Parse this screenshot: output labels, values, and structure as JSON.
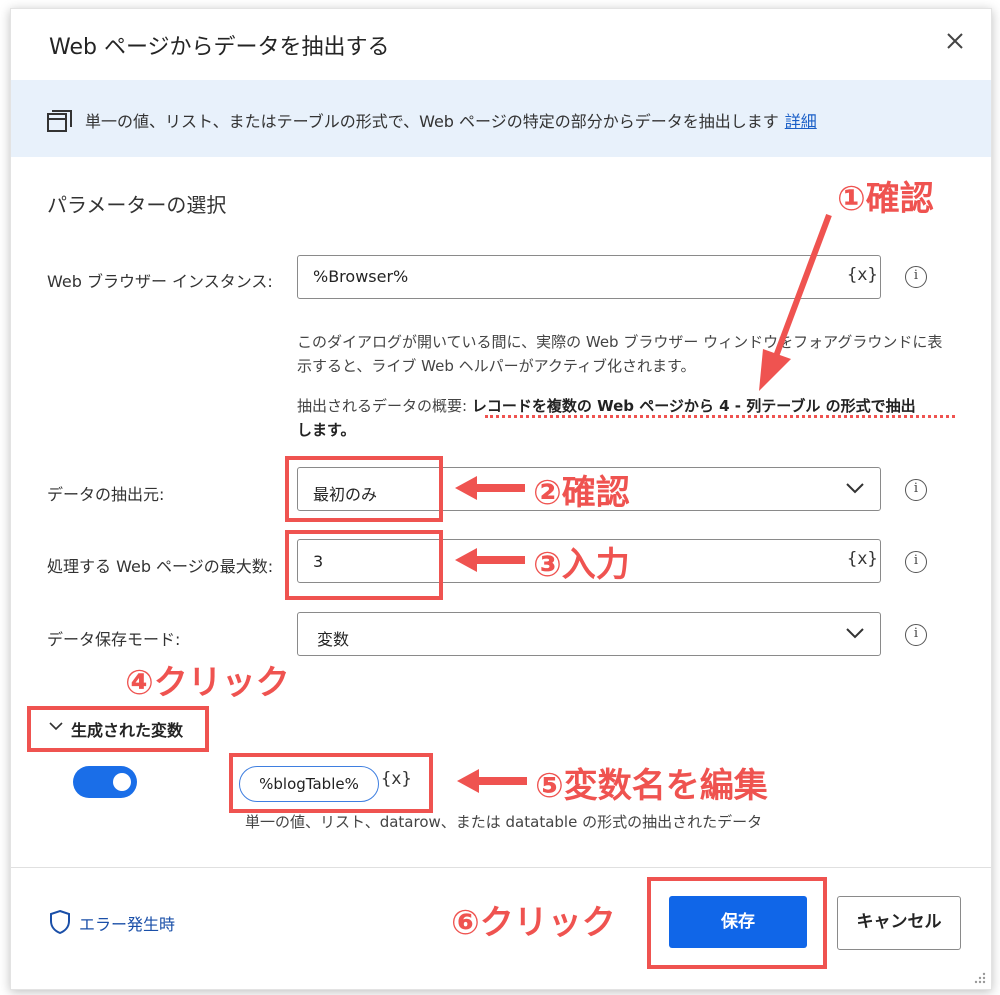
{
  "dialog": {
    "title": "Web ページからデータを抽出する",
    "banner_text": "単一の値、リスト、またはテーブルの形式で、Web ページの特定の部分からデータを抽出します",
    "banner_link": "詳細",
    "section_title": "パラメーターの選択"
  },
  "params": {
    "browser_label": "Web ブラウザー インスタンス:",
    "browser_value": "%Browser%",
    "var_icon": "{x}",
    "help_line1": "このダイアログが開いている間に、実際の Web ブラウザー ウィンドウをフォアグラウンドに表",
    "help_line2": "示すると、ライブ Web ヘルパーがアクティブ化されます。",
    "summary_prefix": "抽出されるデータの概要:",
    "summary_bold": "レコードを複数の Web ページから 4 - 列テーブル の形式で抽出",
    "summary_bold2": "します。",
    "source_label": "データの抽出元:",
    "source_value": "最初のみ",
    "maxpages_label": "処理する Web ページの最大数:",
    "maxpages_value": "3",
    "storage_label": "データ保存モード:",
    "storage_value": "変数"
  },
  "generated": {
    "header": "生成された変数",
    "var_name": "%blogTable%",
    "var_icon": "{x}",
    "description": "単一の値、リスト、datarow、または datatable の形式の抽出されたデータ",
    "toggle_on": true
  },
  "footer": {
    "error_label": "エラー発生時",
    "save": "保存",
    "cancel": "キャンセル"
  },
  "annotations": {
    "a1": "①確認",
    "a2": "②確認",
    "a3": "③入力",
    "a4": "④クリック",
    "a5": "⑤変数名を編集",
    "a6": "⑥クリック",
    "color": "#ef5350"
  },
  "icons": {
    "banner": "window-stack-icon",
    "close": "close-icon",
    "chevron": "chevron-down-icon",
    "info": "info-icon",
    "shield": "shield-icon"
  }
}
